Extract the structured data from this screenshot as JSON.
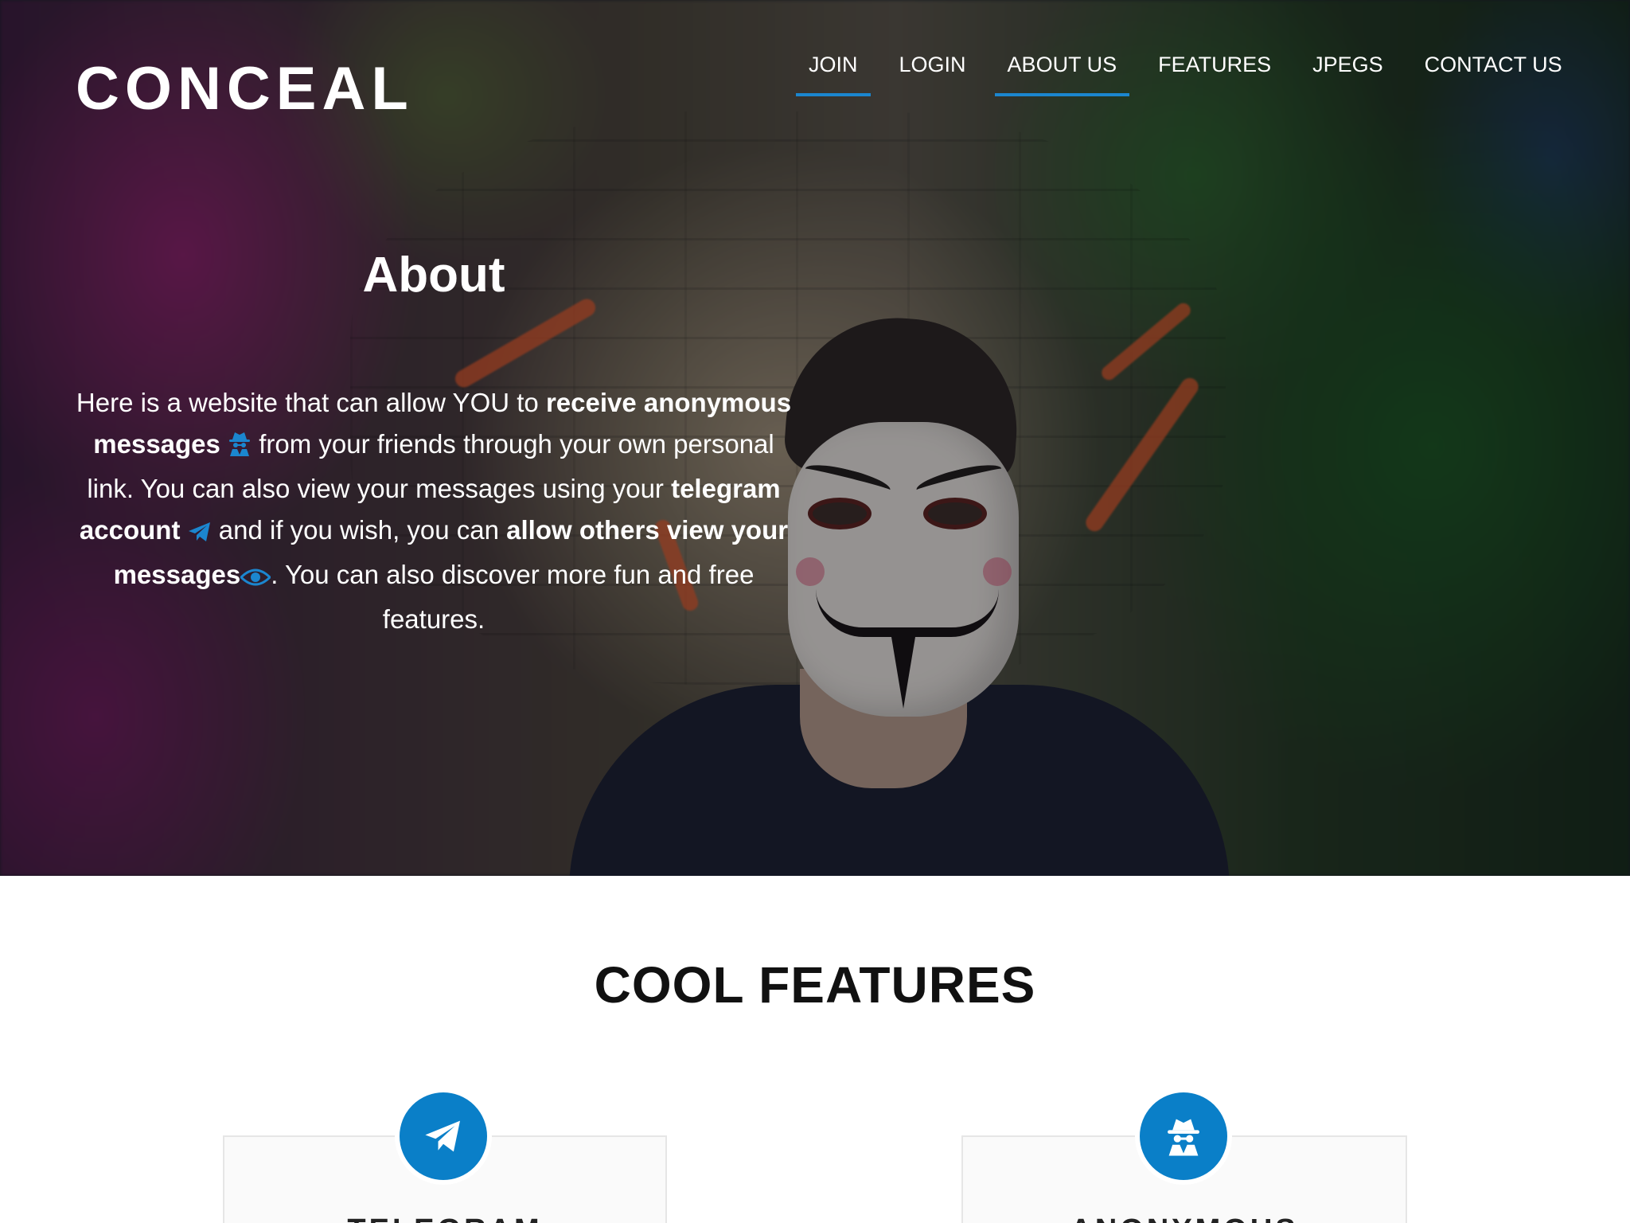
{
  "brand": "CONCEAL",
  "nav": {
    "items": [
      {
        "label": "JOIN",
        "active": true
      },
      {
        "label": "LOGIN",
        "active": false
      },
      {
        "label": "ABOUT US",
        "active": true
      },
      {
        "label": "FEATURES",
        "active": false
      },
      {
        "label": "JPEGS",
        "active": false
      },
      {
        "label": "CONTACT US",
        "active": false
      }
    ]
  },
  "about": {
    "title": "About",
    "text": {
      "p1": "Here is a website that can allow YOU to ",
      "b1": "receive anonymous messages",
      "icon1": "spy-icon",
      "p2": " from your friends through your own personal link. You can also view your messages using your ",
      "b2": "telegram account",
      "icon2": "telegram-icon",
      "p3": " and if you wish, you can ",
      "b3": "allow others view your messages",
      "icon3": "eye-icon",
      "p4": ". You can also discover more fun and free features."
    }
  },
  "features": {
    "title": "COOL FEATURES",
    "cards": [
      {
        "icon": "telegram-icon",
        "label": "TELEGRAM"
      },
      {
        "icon": "spy-icon",
        "label": "ANONYMOUS"
      }
    ]
  },
  "colors": {
    "accent": "#1b86cf",
    "badge": "#0a7fc8"
  }
}
